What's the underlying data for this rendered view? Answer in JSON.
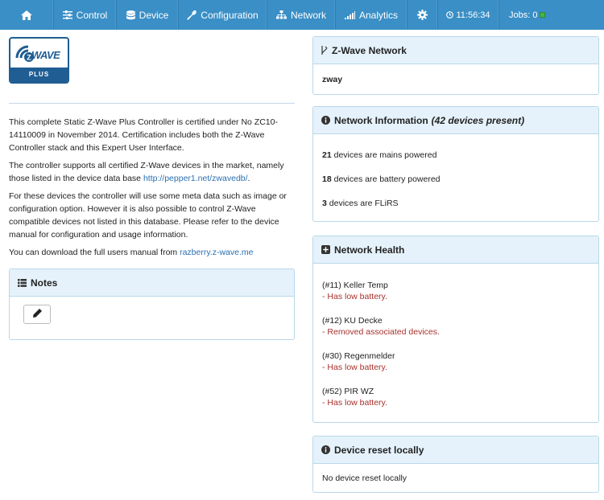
{
  "nav": {
    "control": "Control",
    "device": "Device",
    "configuration": "Configuration",
    "network": "Network",
    "analytics": "Analytics",
    "time": "11:56:34",
    "jobs": "Jobs: 0"
  },
  "logo": {
    "word": "WAVE",
    "z": "Z",
    "plus": "PLUS"
  },
  "intro": {
    "p1": "This complete Static Z-Wave Plus Controller is certified under No ZC10-14110009 in November 2014. Certification includes both the Z-Wave Controller stack and this Expert User Interface.",
    "p2_text": "The controller supports all certified Z-Wave devices in the market, namely those listed in the device data base ",
    "p2_link": "http://pepper1.net/zwavedb/",
    "p2_end": ".",
    "p3": "For these devices the controller will use some meta data such as image or configuration option. However it is also possible to control Z-Wave compatible devices not listed in this database. Please refer to the device manual for configuration and usage information.",
    "p4_text": "You can download the full users manual from ",
    "p4_link": "razberry.z-wave.me"
  },
  "notes": {
    "title": "Notes"
  },
  "zwave_network": {
    "title": "Z-Wave Network",
    "name": "zway"
  },
  "network_info": {
    "title": "Network Information",
    "present": "(42 devices present)",
    "mains_count": "21",
    "mains_text": " devices are mains powered",
    "battery_count": "18",
    "battery_text": " devices are battery powered",
    "flirs_count": "3",
    "flirs_text": " devices are FLiRS"
  },
  "network_health": {
    "title": "Network Health",
    "items": [
      {
        "device": "(#11) Keller Temp",
        "issue": "- Has low battery."
      },
      {
        "device": "(#12) KU Decke",
        "issue": "- Removed associated devices."
      },
      {
        "device": "(#30) Regenmelder",
        "issue": "- Has low battery."
      },
      {
        "device": "(#52) PIR WZ",
        "issue": "- Has low battery."
      }
    ]
  },
  "device_reset": {
    "title": "Device reset locally",
    "text": "No device reset locally"
  },
  "colors": {
    "nav": "#3a8fc6",
    "panel_head": "#e5f2fb",
    "warning": "#a7312b",
    "link": "#2a6fb0"
  }
}
